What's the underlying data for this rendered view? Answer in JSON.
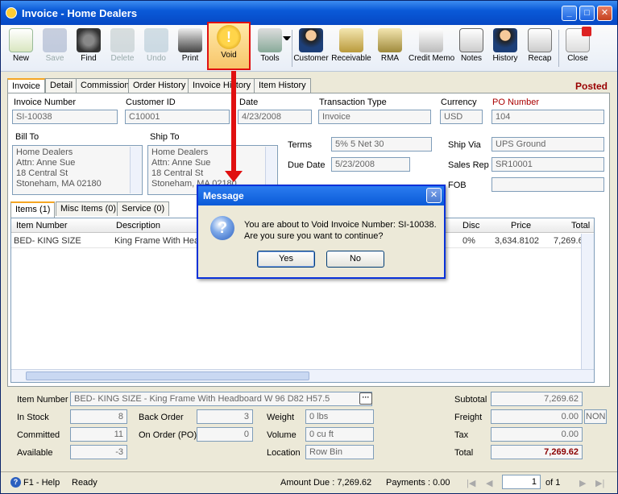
{
  "window": {
    "title": "Invoice - Home Dealers"
  },
  "toolbar": {
    "new": "New",
    "save": "Save",
    "find": "Find",
    "delete": "Delete",
    "undo": "Undo",
    "print": "Print",
    "void": "Void",
    "tools": "Tools",
    "customer": "Customer",
    "receivable": "Receivable",
    "rma": "RMA",
    "credit_memo": "Credit Memo",
    "notes": "Notes",
    "history": "History",
    "recap": "Recap",
    "close": "Close"
  },
  "status_badge": "Posted",
  "tabs": [
    "Invoice",
    "Detail",
    "Commission",
    "Order History",
    "Invoice History",
    "Item History"
  ],
  "header": {
    "invoice_number_label": "Invoice Number",
    "invoice_number": "SI-10038",
    "customer_id_label": "Customer ID",
    "customer_id": "C10001",
    "date_label": "Date",
    "date": "4/23/2008",
    "transaction_type_label": "Transaction Type",
    "transaction_type": "Invoice",
    "currency_label": "Currency",
    "currency": "USD",
    "po_number_label": "PO Number",
    "po_number": "104",
    "bill_to_label": "Bill To",
    "ship_to_label": "Ship To",
    "bill_to": [
      "Home Dealers",
      "Attn: Anne Sue",
      "18 Central St",
      "Stoneham, MA 02180"
    ],
    "ship_to": [
      "Home Dealers",
      "Attn: Anne Sue",
      "18 Central St",
      "Stoneham, MA 02180"
    ],
    "terms_label": "Terms",
    "terms": "5% 5 Net 30",
    "due_date_label": "Due Date",
    "due_date": "5/23/2008",
    "ship_via_label": "Ship Via",
    "ship_via": "UPS Ground",
    "sales_rep_label": "Sales Rep",
    "sales_rep": "SR10001",
    "fob_label": "FOB",
    "fob": ""
  },
  "item_tabs": [
    "Items (1)",
    "Misc Items (0)",
    "Service (0)"
  ],
  "grid": {
    "columns": [
      "Item Number",
      "Description",
      "Disc",
      "Price",
      "Total"
    ],
    "rows": [
      {
        "item": "BED- KING SIZE",
        "description": "King Frame With  Hea",
        "disc": "0%",
        "price": "3,634.8102",
        "total": "7,269.62"
      }
    ]
  },
  "footer": {
    "item_number_label": "Item Number",
    "item_number": "BED- KING SIZE - King Frame With  Headboard W 96 D82  H57.5",
    "in_stock_label": "In Stock",
    "in_stock": "8",
    "committed_label": "Committed",
    "committed": "11",
    "available_label": "Available",
    "available": "-3",
    "back_order_label": "Back Order",
    "back_order": "3",
    "on_order_label": "On Order (PO)",
    "on_order": "0",
    "weight_label": "Weight",
    "weight": "0 lbs",
    "volume_label": "Volume",
    "volume": "0 cu ft",
    "location_label": "Location",
    "location": "Row  Bin",
    "subtotal_label": "Subtotal",
    "subtotal": "7,269.62",
    "freight_label": "Freight",
    "freight": "0.00",
    "freight_code": "NON",
    "tax_label": "Tax",
    "tax": "0.00",
    "total_label": "Total",
    "total": "7,269.62"
  },
  "status": {
    "help": "F1 - Help",
    "state": "Ready",
    "amount_due": "Amount Due : 7,269.62",
    "payments": "Payments : 0.00",
    "page": "1",
    "of": "of  1"
  },
  "dialog": {
    "title": "Message",
    "line1": "You are about to Void Invoice Number: SI-10038.",
    "line2": "Are you sure you want to continue?",
    "yes": "Yes",
    "no": "No"
  },
  "colors": {
    "accent": "#0a5ad8",
    "highlight": "#e01010",
    "posted": "#990000"
  }
}
